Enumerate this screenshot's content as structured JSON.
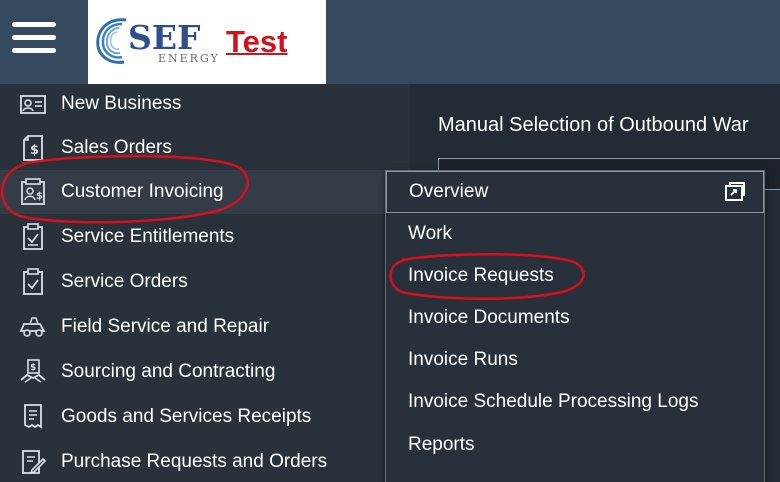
{
  "header": {
    "logo_text": "SEF",
    "logo_sub": "ENERGY",
    "environment_label": "Test"
  },
  "sidebar": {
    "items": [
      {
        "label": "New Business",
        "icon": "new-business-icon"
      },
      {
        "label": "Sales Orders",
        "icon": "sales-orders-icon"
      },
      {
        "label": "Customer Invoicing",
        "icon": "customer-invoicing-icon"
      },
      {
        "label": "Service Entitlements",
        "icon": "service-entitlements-icon"
      },
      {
        "label": "Service Orders",
        "icon": "service-orders-icon"
      },
      {
        "label": "Field Service and Repair",
        "icon": "field-service-icon"
      },
      {
        "label": "Sourcing and Contracting",
        "icon": "sourcing-icon"
      },
      {
        "label": "Goods and Services Receipts",
        "icon": "receipts-icon"
      },
      {
        "label": "Purchase Requests and Orders",
        "icon": "purchase-icon"
      }
    ]
  },
  "content": {
    "title": "Manual Selection of Outbound War"
  },
  "submenu": {
    "items": [
      {
        "label": "Overview"
      },
      {
        "label": "Work"
      },
      {
        "label": "Invoice Requests"
      },
      {
        "label": "Invoice Documents"
      },
      {
        "label": "Invoice Runs"
      },
      {
        "label": "Invoice Schedule Processing Logs"
      },
      {
        "label": "Reports"
      }
    ],
    "launch_icon": "open-in-new-window-icon"
  },
  "colors": {
    "topbar": "#354a5f",
    "sidebar": "#29313a",
    "annotation": "#d8101a",
    "logo_blue": "#2d4f8c",
    "test_red": "#d0121a"
  }
}
